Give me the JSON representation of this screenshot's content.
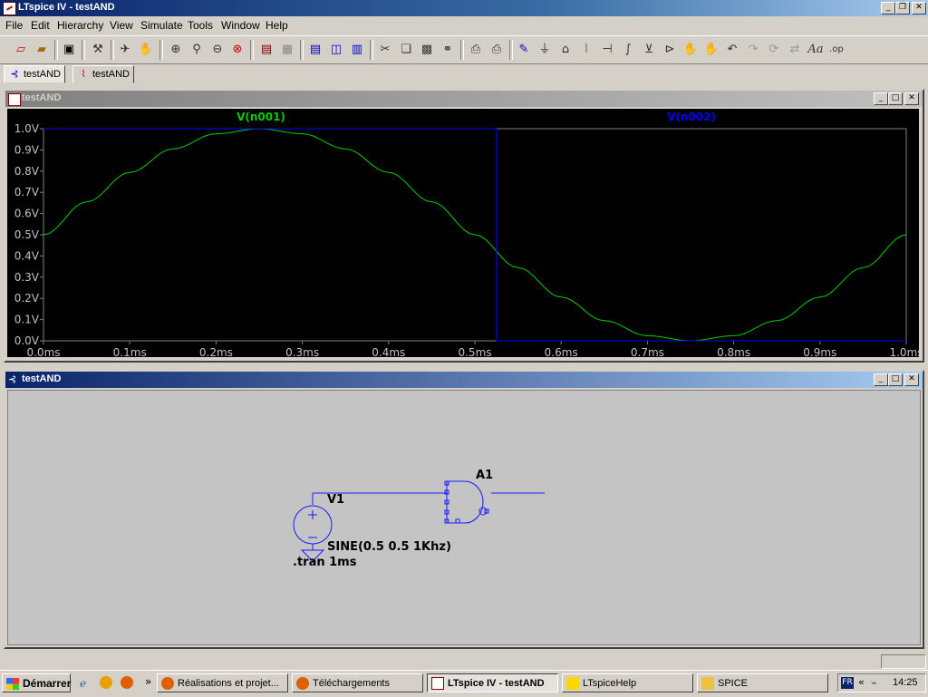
{
  "app": {
    "title": "LTspice IV - testAND"
  },
  "menu": [
    "File",
    "Edit",
    "Hierarchy",
    "View",
    "Simulate",
    "Tools",
    "Window",
    "Help"
  ],
  "toolbar_icons": [
    "new-schematic-icon",
    "open-icon",
    "save-icon",
    "control-panel-icon",
    "run-icon",
    "halt-icon",
    "zoom-in-icon",
    "zoom-area-icon",
    "zoom-out-icon",
    "zoom-cancel-icon",
    "autorange-icon",
    "grid-icon",
    "tile-horizontal-icon",
    "cascade-icon",
    "tile-vertical-icon",
    "cut-icon",
    "copy-icon",
    "paste-icon",
    "find-icon",
    "print-setup-icon",
    "print-icon",
    "wire-icon",
    "ground-icon",
    "label-net-icon",
    "resistor-icon",
    "capacitor-icon",
    "inductor-icon",
    "diode-icon",
    "component-icon",
    "move-icon",
    "drag-icon",
    "undo-icon",
    "redo-icon",
    "rotate-icon",
    "mirror-icon",
    "text-icon",
    "spice-directive-icon"
  ],
  "tabs": [
    {
      "label": "testAND"
    },
    {
      "label": "testAND"
    }
  ],
  "plot_window": {
    "title": "testAND"
  },
  "schematic_window": {
    "title": "testAND"
  },
  "chart_data": {
    "type": "line",
    "x": [
      0.0,
      0.05,
      0.1,
      0.15,
      0.2,
      0.25,
      0.3,
      0.35,
      0.4,
      0.45,
      0.5,
      0.55,
      0.6,
      0.65,
      0.7,
      0.75,
      0.8,
      0.85,
      0.9,
      0.95,
      1.0
    ],
    "series": [
      {
        "name": "V(n001)",
        "color": "#00d000",
        "values": [
          0.5,
          0.655,
          0.794,
          0.905,
          0.976,
          1.0,
          0.976,
          0.905,
          0.794,
          0.655,
          0.5,
          0.345,
          0.206,
          0.095,
          0.024,
          0.0,
          0.024,
          0.095,
          0.206,
          0.345,
          0.5
        ]
      },
      {
        "name": "V(n002)",
        "color": "#0000ff",
        "values": [
          1.0,
          1.0,
          1.0,
          1.0,
          1.0,
          1.0,
          1.0,
          1.0,
          1.0,
          1.0,
          1.0,
          0.0,
          0.0,
          0.0,
          0.0,
          0.0,
          0.0,
          0.0,
          0.0,
          0.0,
          0.0
        ]
      }
    ],
    "xlim": [
      0.0,
      1.0
    ],
    "ylim": [
      0.0,
      1.0
    ],
    "xticks": [
      "0.0ms",
      "0.1ms",
      "0.2ms",
      "0.3ms",
      "0.4ms",
      "0.5ms",
      "0.6ms",
      "0.7ms",
      "0.8ms",
      "0.9ms",
      "1.0ms"
    ],
    "yticks": [
      "0.0V",
      "0.1V",
      "0.2V",
      "0.3V",
      "0.4V",
      "0.5V",
      "0.6V",
      "0.7V",
      "0.8V",
      "0.9V",
      "1.0V"
    ],
    "legend": "top",
    "grid": false
  },
  "schematic": {
    "source_name": "V1",
    "source_value": "SINE(0.5 0.5 1Khz)",
    "directive": ".tran 1ms",
    "gate_name": "A1"
  },
  "taskbar": {
    "start": "Démarrer",
    "tasks": [
      "Réalisations et projet...",
      "Téléchargements",
      "LTspice IV - testAND",
      "LTspiceHelp",
      "SPICE"
    ],
    "lang": "FR",
    "clock": "14:25"
  }
}
